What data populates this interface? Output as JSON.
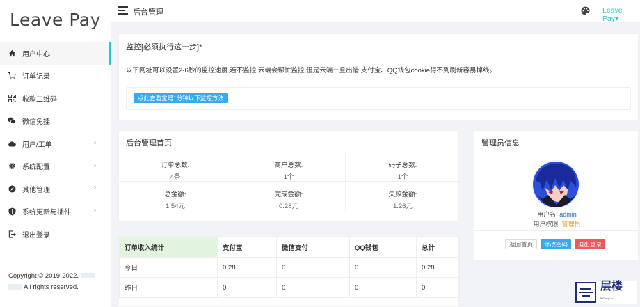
{
  "sidebar": {
    "logo": "Leave Pay",
    "items": [
      {
        "label": "用户中心",
        "icon": "home-icon",
        "active": true
      },
      {
        "label": "订单记录",
        "icon": "cart-icon"
      },
      {
        "label": "收款二维码",
        "icon": "qrcode-icon"
      },
      {
        "label": "微信免挂",
        "icon": "wechat-icon"
      },
      {
        "label": "用户/工单",
        "icon": "cloud-icon",
        "arrow": "›"
      },
      {
        "label": "系统配置",
        "icon": "gear-icon",
        "arrow": "›"
      },
      {
        "label": "其他管理",
        "icon": "compass-icon",
        "arrow": "›"
      },
      {
        "label": "系统更新与插件",
        "icon": "shield-icon",
        "arrow": "›"
      },
      {
        "label": "退出登录",
        "icon": "logout-icon"
      }
    ],
    "copyright_line1": "Copyright © 2019-2022.",
    "copyright_line2": "All rights reserved."
  },
  "topbar": {
    "title": "后台管理",
    "user": "Leave Pay",
    "user_caret": "▾",
    "palette_icon": "palette-icon",
    "menu_icon": "hamburger-icon"
  },
  "monitor": {
    "title": "监控[必须执行这一步]*",
    "description": "以下网址可以设置2-6秒的监控速度,若不监控,云端会帮忙监控,但是云端一旦出错,支付宝、QQ钱包cookie得不到刷新容易掉线。",
    "button": "点此查看宝塔1分钟以下监控方法"
  },
  "stats": {
    "title": "后台管理首页",
    "cells": [
      {
        "label": "订单总数:",
        "value": "4条"
      },
      {
        "label": "商户总数:",
        "value": "1个"
      },
      {
        "label": "码子总数:",
        "value": "1个"
      },
      {
        "label": "总金额:",
        "value": "1.54元"
      },
      {
        "label": "完成金额:",
        "value": "0.28元"
      },
      {
        "label": "失败金额:",
        "value": "1.26元"
      }
    ]
  },
  "admin": {
    "title": "管理员信息",
    "username_label": "用户名:",
    "username": "admin",
    "role_label": "用户权限:",
    "role": "管理员",
    "buttons": {
      "back": "返回首页",
      "edit": "修改密码",
      "logout": "退出登录"
    }
  },
  "income": {
    "headers": [
      "订单收入统计",
      "支付宝",
      "微信支付",
      "QQ钱包",
      "总计"
    ],
    "rows": [
      {
        "label": "今日",
        "values": [
          "0.28",
          "0",
          "0",
          "0.28"
        ]
      },
      {
        "label": "昨日",
        "values": [
          "0",
          "0",
          "0",
          "0"
        ]
      }
    ]
  },
  "watermark": {
    "text": "层楼",
    "sub": "BiCengLou"
  },
  "colors": {
    "accent": "#2ec7c9",
    "primary_button": "#39a8ee",
    "danger_button": "#f0565a",
    "table_header_first": "#e2f3de"
  }
}
